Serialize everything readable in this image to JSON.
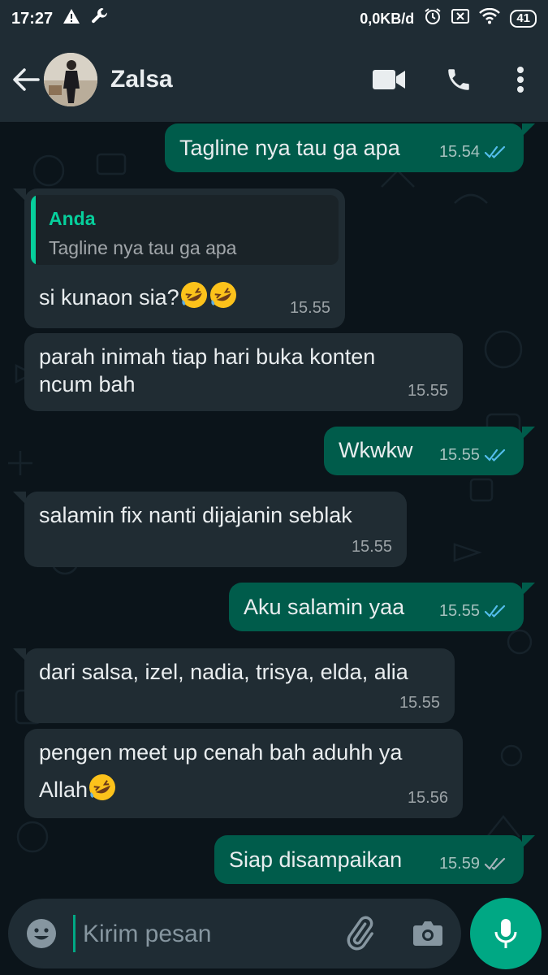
{
  "status_bar": {
    "time": "17:27",
    "network_speed": "0,0KB/d",
    "battery": "41",
    "icons": [
      "warning-icon",
      "wrench-icon",
      "alarm-icon",
      "no-sim-icon",
      "wifi-icon"
    ]
  },
  "header": {
    "contact_name": "Zalsa",
    "icons": [
      "back-arrow-icon",
      "video-call-icon",
      "voice-call-icon",
      "more-options-icon"
    ]
  },
  "messages": [
    {
      "direction": "out",
      "text": "Tagline nya tau ga apa",
      "time": "15.54",
      "status": "read"
    },
    {
      "direction": "in",
      "quote": {
        "author": "Anda",
        "text": "Tagline nya tau ga apa"
      },
      "text": "si kunaon sia?",
      "emoji_count": 2,
      "time": "15.55"
    },
    {
      "direction": "in",
      "lines": [
        "parah inimah tiap hari buka konten",
        "ncum bah"
      ],
      "time": "15.55"
    },
    {
      "direction": "out",
      "text": "Wkwkw",
      "time": "15.55",
      "status": "read"
    },
    {
      "direction": "in",
      "text": "salamin fix nanti dijajanin seblak",
      "time": "15.55"
    },
    {
      "direction": "out",
      "text": "Aku salamin yaa",
      "time": "15.55",
      "status": "read"
    },
    {
      "direction": "in",
      "text": "dari salsa, izel, nadia, trisya, elda, alia",
      "time": "15.55"
    },
    {
      "direction": "in",
      "lines": [
        "pengen meet up cenah bah aduhh ya",
        "Allah"
      ],
      "emoji_count": 1,
      "time": "15.56"
    },
    {
      "direction": "out",
      "text": "Siap disampaikan",
      "time": "15.59",
      "status": "delivered"
    }
  ],
  "input_bar": {
    "placeholder": "Kirim pesan",
    "value": "",
    "icons": [
      "emoji-icon",
      "attach-icon",
      "camera-icon",
      "mic-icon"
    ]
  },
  "colors": {
    "background": "#0b141a",
    "header": "#1f2c34",
    "incoming_bubble": "#202c33",
    "outgoing_bubble": "#005c4b",
    "accent": "#00a884",
    "read_ticks": "#53bdeb",
    "delivered_ticks": "#a6b3ba"
  }
}
